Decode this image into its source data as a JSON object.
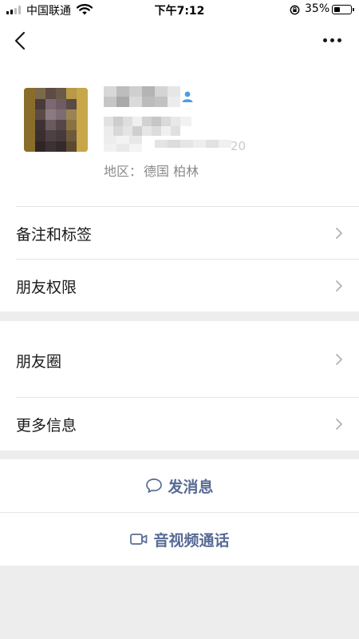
{
  "status_bar": {
    "carrier": "中国联通",
    "time": "下午7:12",
    "battery": "35%",
    "battery_level": 0.35,
    "signal_bars": 2
  },
  "nav": {
    "back_icon": "chevron-left-icon",
    "more_icon": "more-dots-icon"
  },
  "profile": {
    "gender_icon": "person-icon",
    "gender_color": "#4d9be5",
    "id_suffix": "20",
    "region_label": "地区：",
    "region_value": "德国 柏林"
  },
  "menu": {
    "remark_tags": "备注和标签",
    "friend_permissions": "朋友权限",
    "moments": "朋友圈",
    "more_info": "更多信息"
  },
  "actions": {
    "send_message": "发消息",
    "message_icon": "chat-bubble-icon",
    "video_call": "音视频通话",
    "video_icon": "video-camera-icon"
  },
  "colors": {
    "link": "#576b95",
    "background": "#ededed",
    "divider": "#e5e5e5"
  }
}
